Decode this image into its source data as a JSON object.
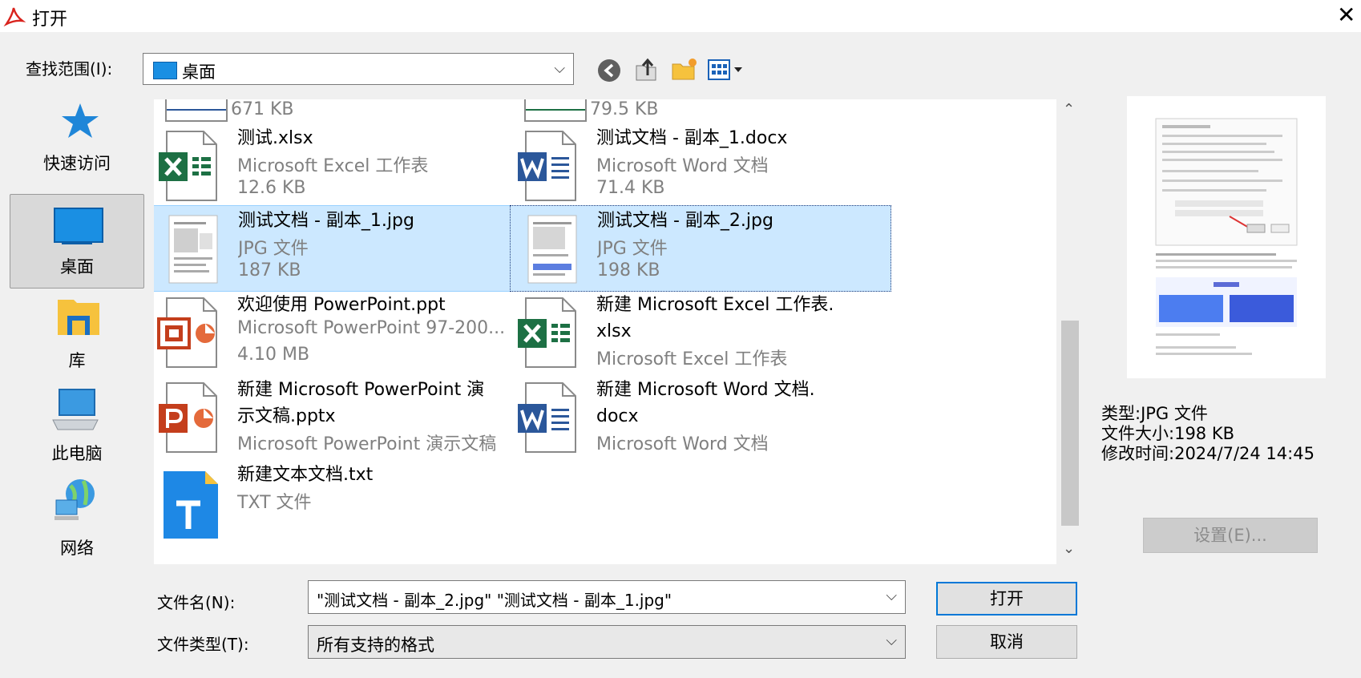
{
  "window": {
    "title": "打开",
    "close_label": "✕"
  },
  "lookin": {
    "label": "查找范围(I):",
    "value": "桌面"
  },
  "toolbar": {
    "icons": [
      "back-icon",
      "up-folder-icon",
      "new-folder-icon",
      "view-menu-icon"
    ]
  },
  "places": [
    {
      "label": "快速访问",
      "icon": "star-icon"
    },
    {
      "label": "桌面",
      "icon": "desktop-icon",
      "selected": true
    },
    {
      "label": "库",
      "icon": "library-icon"
    },
    {
      "label": "此电脑",
      "icon": "computer-icon"
    },
    {
      "label": "网络",
      "icon": "network-icon"
    }
  ],
  "files": {
    "partial_top_left": {
      "size": "671 KB"
    },
    "partial_top_right": {
      "size": "79.5 KB"
    },
    "items": [
      {
        "name": "测试.xlsx",
        "type": "Microsoft Excel 工作表",
        "size": "12.6 KB",
        "icon": "excel-icon"
      },
      {
        "name": "测试文档 - 副本_1.docx",
        "type": "Microsoft Word 文档",
        "size": "71.4 KB",
        "icon": "word-icon"
      },
      {
        "name": "测试文档 - 副本_1.jpg",
        "type": "JPG 文件",
        "size": "187 KB",
        "icon": "image-thumbnail",
        "selected": true
      },
      {
        "name": "测试文档 - 副本_2.jpg",
        "type": "JPG 文件",
        "size": "198 KB",
        "icon": "image-thumbnail",
        "selected": true,
        "focused": true
      },
      {
        "name": "欢迎使用 PowerPoint.ppt",
        "type": "Microsoft PowerPoint 97-200...",
        "size": "4.10 MB",
        "icon": "powerpoint-legacy-icon"
      },
      {
        "name": "新建 Microsoft Excel 工作表.\nxlsx",
        "type": "Microsoft Excel 工作表",
        "size": "",
        "icon": "excel-icon"
      },
      {
        "name": "新建 Microsoft PowerPoint 演\n示文稿.pptx",
        "type": "Microsoft PowerPoint 演示文稿",
        "size": "",
        "icon": "powerpoint-icon"
      },
      {
        "name": "新建 Microsoft Word 文档.\ndocx",
        "type": "Microsoft Word 文档",
        "size": "",
        "icon": "word-icon"
      },
      {
        "name": "新建文本文档.txt",
        "type": "TXT 文件",
        "size": "",
        "icon": "text-icon"
      }
    ]
  },
  "preview_info": {
    "type_label": "类型:",
    "type_value": "JPG 文件",
    "size_label": "文件大小:",
    "size_value": "198 KB",
    "mtime_label": "修改时间:",
    "mtime_value": "2024/7/24 14:45"
  },
  "settings_button": "设置(E)...",
  "filename": {
    "label": "文件名(N):",
    "value": "\"测试文档 - 副本_2.jpg\" \"测试文档 - 副本_1.jpg\""
  },
  "filetype": {
    "label": "文件类型(T):",
    "value": "所有支持的格式"
  },
  "buttons": {
    "open": "打开",
    "cancel": "取消"
  },
  "colors": {
    "selection": "#cce8ff",
    "accent": "#0078d7",
    "excel": "#1d7044",
    "word": "#2b579a",
    "powerpoint": "#c43e1c",
    "txt": "#1e88e5"
  }
}
